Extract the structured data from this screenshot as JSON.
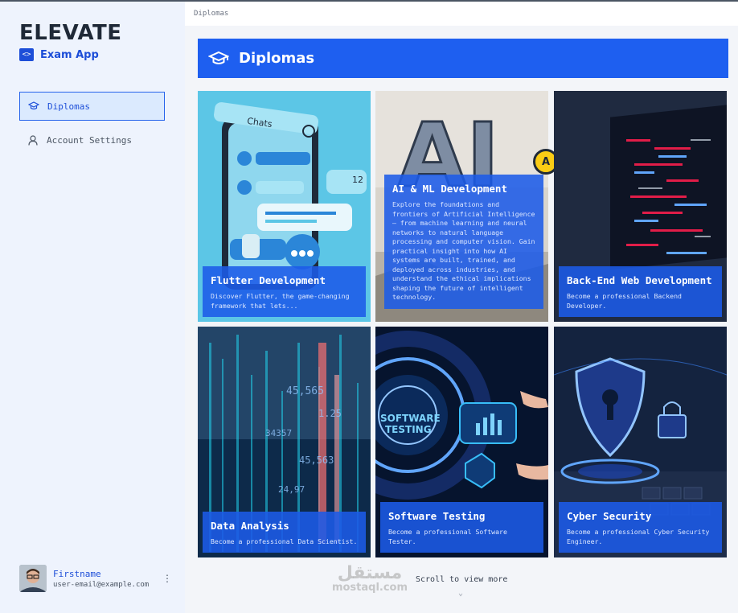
{
  "brand": {
    "logo": "ELEVATE",
    "app_name": "Exam App",
    "app_icon": "<>"
  },
  "nav": {
    "items": [
      {
        "label": "Diplomas",
        "icon": "graduation-cap-icon",
        "active": true
      },
      {
        "label": "Account Settings",
        "icon": "user-icon",
        "active": false
      }
    ]
  },
  "user": {
    "name": "Firstname",
    "email": "user-email@example.com"
  },
  "breadcrumb": "Diplomas",
  "header": {
    "title": "Diplomas",
    "icon": "graduation-cap-icon"
  },
  "cards": [
    {
      "title": "Flutter Development",
      "description": "Discover Flutter, the game-changing framework that lets..."
    },
    {
      "title": "AI & ML Development",
      "description": "Explore the foundations and frontiers of Artificial Intelligence — from machine learning and neural networks to natural language processing and computer vision. Gain practical insight into how AI systems are built, trained, and deployed across industries, and understand the ethical implications shaping the future of intelligent technology.",
      "badge": "A"
    },
    {
      "title": "Back-End Web Development",
      "description": "Become a professional Backend Developer."
    },
    {
      "title": "Data Analysis",
      "description": "Become a professional Data Scientist."
    },
    {
      "title": "Software Testing",
      "description": "Become a professional Software Tester."
    },
    {
      "title": "Cyber Security",
      "description": "Become a professional Cyber Security Engineer."
    }
  ],
  "card_art": {
    "flutter": {
      "chats_label": "Chats",
      "count": "12"
    },
    "ai": {
      "letters": "AI"
    },
    "testing": {
      "label_line1": "SOFTWARE",
      "label_line2": "TESTING"
    },
    "data": {
      "numbers": [
        "45,565",
        "34357",
        "1.25",
        "45,563",
        "24,97"
      ]
    }
  },
  "scroll_hint": "Scroll to view more",
  "watermark": {
    "arabic": "مستقل",
    "latin": "mostaql.com"
  },
  "colors": {
    "primary": "#1e5ff0",
    "sidebar_bg": "#eef3fd",
    "active_nav_bg": "#dbeafe"
  }
}
